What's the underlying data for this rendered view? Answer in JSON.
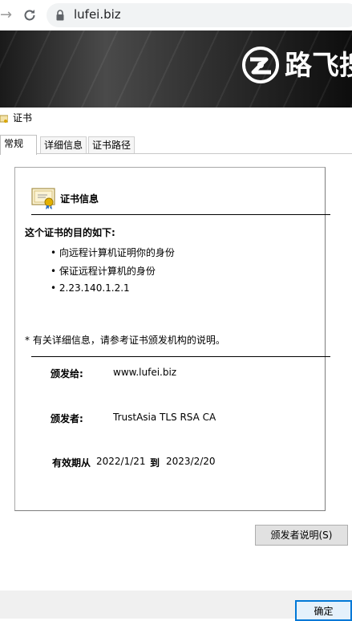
{
  "browser": {
    "url": "lufei.biz"
  },
  "banner": {
    "brand_text": "路飞搜"
  },
  "dialog": {
    "title": "证书",
    "tabs": [
      {
        "label": "常规"
      },
      {
        "label": "详细信息"
      },
      {
        "label": "证书路径"
      }
    ],
    "info_title": "证书信息",
    "purpose_heading": "这个证书的目的如下:",
    "purposes": [
      "• 向远程计算机证明你的身份",
      "• 保证远程计算机的身份",
      "• 2.23.140.1.2.1"
    ],
    "note": "* 有关详细信息，请参考证书颁发机构的说明。",
    "issued_to_label": "颁发给:",
    "issued_to_value": "www.lufei.biz",
    "issued_by_label": "颁发者:",
    "issued_by_value": "TrustAsia TLS RSA CA",
    "valid_from_label": "有效期从",
    "valid_from_value": "2022/1/21",
    "valid_to_label": "到",
    "valid_to_value": "2023/2/20",
    "issuer_statement_button": "颁发者说明(S)",
    "ok_button": "确定"
  }
}
